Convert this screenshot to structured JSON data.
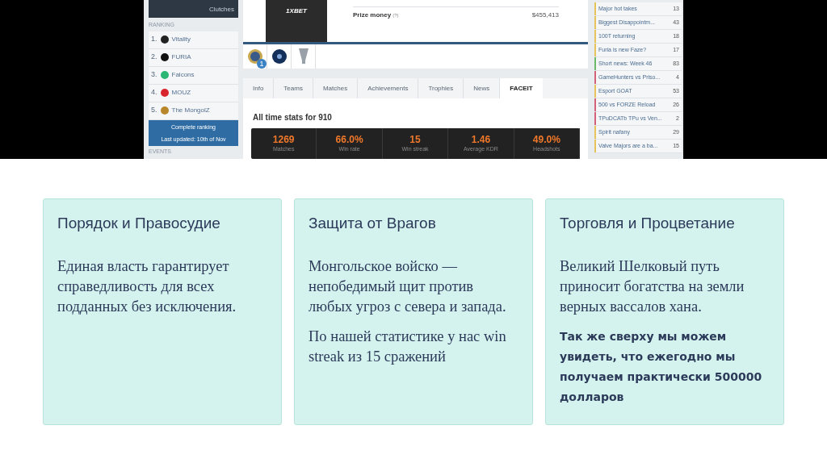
{
  "screenshot": {
    "sidebar": {
      "stat_label": "Clutches",
      "ranking_heading": "RANKING",
      "ranking": [
        {
          "rank": "1.",
          "team": "Vitality",
          "color": "#222222"
        },
        {
          "rank": "2.",
          "team": "FURIA",
          "color": "#111111"
        },
        {
          "rank": "3.",
          "team": "Falcons",
          "color": "#2bb673"
        },
        {
          "rank": "4.",
          "team": "MOUZ",
          "color": "#d9262e"
        },
        {
          "rank": "5.",
          "team": "The MongolZ",
          "color": "#b8862b"
        }
      ],
      "ranking_button": "Complete ranking",
      "ranking_updated": "Last updated: 10th of Nov",
      "events_heading": "EVENTS"
    },
    "player": {
      "jersey_text": "1XBET",
      "prize_label": "Prize money",
      "prize_hint": "(?)",
      "prize_value": "$455,413",
      "trophy_count": "1"
    },
    "tabs": [
      {
        "label": "Info",
        "selected": false
      },
      {
        "label": "Teams",
        "selected": false
      },
      {
        "label": "Matches",
        "selected": false
      },
      {
        "label": "Achievements",
        "selected": false
      },
      {
        "label": "Trophies",
        "selected": false
      },
      {
        "label": "News",
        "selected": false
      },
      {
        "label": "FACEIT",
        "selected": true
      }
    ],
    "stats_title": "All time stats for 910",
    "stats": [
      {
        "value": "1269",
        "label": "Matches"
      },
      {
        "value": "66.0%",
        "label": "Win rate"
      },
      {
        "value": "15",
        "label": "Win streak"
      },
      {
        "value": "1.46",
        "label": "Average KDR"
      },
      {
        "value": "49.0%",
        "label": "Headshots"
      }
    ],
    "threads": [
      {
        "title": "Major hot takes",
        "count": "13",
        "color": "#e8c25a"
      },
      {
        "title": "Biggest Disappointm...",
        "count": "43",
        "color": "#e8c25a"
      },
      {
        "title": "100T returning",
        "count": "18",
        "color": "#e8c25a"
      },
      {
        "title": "Furia is new Faze?",
        "count": "17",
        "color": "#e8c25a"
      },
      {
        "title": "Short news: Week 46",
        "count": "83",
        "color": "#6cb86a"
      },
      {
        "title": "GameHunters vs Priso...",
        "count": "4",
        "color": "#d4607a"
      },
      {
        "title": "Esport GOAT",
        "count": "53",
        "color": "#e8c25a"
      },
      {
        "title": "500 vs FORZE Reload",
        "count": "26",
        "color": "#d4607a"
      },
      {
        "title": "TPuDCATb TPu vs Ven...",
        "count": "2",
        "color": "#d4607a"
      },
      {
        "title": "Spirit nafany",
        "count": "29",
        "color": "#e8c25a"
      },
      {
        "title": "Valve Majors are a ba...",
        "count": "15",
        "color": "#e8c25a"
      }
    ]
  },
  "cards": [
    {
      "title": "Порядок и Правосудие",
      "paragraphs": [
        {
          "kind": "serif",
          "text": "Единая власть гарантирует справедливость для всех подданных без исключения."
        }
      ]
    },
    {
      "title": "Защита от Врагов",
      "paragraphs": [
        {
          "kind": "serif",
          "text": "Монгольское войско — непобедимый щит против любых угроз с севера и запада."
        },
        {
          "kind": "serif",
          "text": "По нашей статистике у нас win streak из 15 сражений"
        }
      ]
    },
    {
      "title": "Торговля и Процветание",
      "paragraphs": [
        {
          "kind": "serif",
          "text": "Великий Шелковый путь приносит богатства на земли верных вассалов хана."
        },
        {
          "kind": "sans",
          "text": "Так же сверху мы можем увидеть, что ежегодно мы получаем практически 500000 долларов"
        }
      ]
    }
  ]
}
